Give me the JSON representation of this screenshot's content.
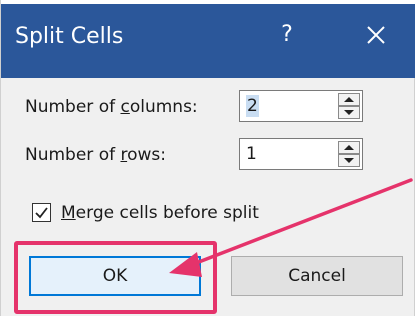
{
  "dialog": {
    "title": "Split Cells",
    "help_glyph": "?",
    "columns_label_pre": "Number of ",
    "columns_label_accel": "c",
    "columns_label_post": "olumns:",
    "columns_value": "2",
    "rows_label_pre": "Number of ",
    "rows_label_accel": "r",
    "rows_label_post": "ows:",
    "rows_value": "1",
    "merge_label_accel": "M",
    "merge_label_post": "erge cells before split",
    "merge_checked": true,
    "ok_label": "OK",
    "cancel_label": "Cancel"
  },
  "colors": {
    "titlebar": "#2b579a",
    "annotation": "#e5336b",
    "focus": "#0078d7"
  },
  "icons": {
    "close": "close-icon",
    "spin_up": "chevron-up-icon",
    "spin_down": "chevron-down-icon",
    "check": "checkmark-icon",
    "annotation_arrow": "arrow-icon"
  }
}
